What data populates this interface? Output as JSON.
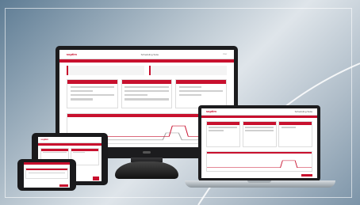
{
  "app": {
    "logo_text": "soptim",
    "title": "Scheduling Suite",
    "user": "User"
  },
  "devices": [
    "monitor",
    "laptop",
    "tablet",
    "phone"
  ],
  "colors": {
    "accent": "#c8102e",
    "device_frame": "#1c1c1e",
    "screen_bg": "#ffffff"
  }
}
